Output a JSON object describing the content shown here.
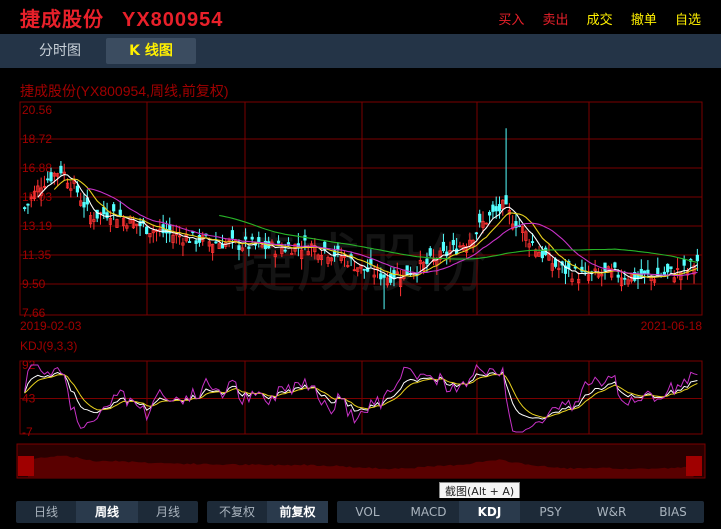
{
  "header": {
    "name": "捷成股份",
    "code": "YX800954",
    "actions": [
      {
        "label": "买入",
        "color": "#e8202a"
      },
      {
        "label": "卖出",
        "color": "#e8202a"
      },
      {
        "label": "成交",
        "color": "#fff000"
      },
      {
        "label": "撤单",
        "color": "#fff000"
      },
      {
        "label": "自选",
        "color": "#fff000"
      }
    ]
  },
  "tabs": {
    "timeshare": "分时图",
    "kline": "K 线图"
  },
  "chart_data": {
    "type": "candlestick",
    "title": "捷成股份(YX800954,周线,前复权)",
    "watermark": "捷成股份",
    "ylabels": [
      "20.56",
      "18.72",
      "16.88",
      "15.03",
      "13.19",
      "11.35",
      "9.50",
      "7.66"
    ],
    "ylim": [
      7.66,
      20.56
    ],
    "period_start": "2019-02-03",
    "period_end": "2021-06-18",
    "ma_colors": [
      "#ffffff",
      "#e8d11e",
      "#c832c8",
      "#28b428"
    ],
    "kdj": {
      "label": "KDJ(9,3,3)",
      "ylabels": [
        "92",
        "43",
        "-7"
      ],
      "ylim": [
        -7,
        92
      ],
      "colors": [
        "#ffffff",
        "#e8d11e",
        "#c832c8"
      ]
    },
    "colors": {
      "up": "#ff3232",
      "down": "#54ffff",
      "grid": "#7a0000",
      "text": "#a00000"
    }
  },
  "tooltip": "截图(Alt + A)",
  "bottom": {
    "periods": [
      "日线",
      "周线",
      "月线"
    ],
    "active_period": 1,
    "adjust": [
      "不复权",
      "前复权"
    ],
    "active_adjust": 1,
    "indicators": [
      "VOL",
      "MACD",
      "KDJ",
      "PSY",
      "W&R",
      "BIAS"
    ],
    "active_indicator": 2
  }
}
